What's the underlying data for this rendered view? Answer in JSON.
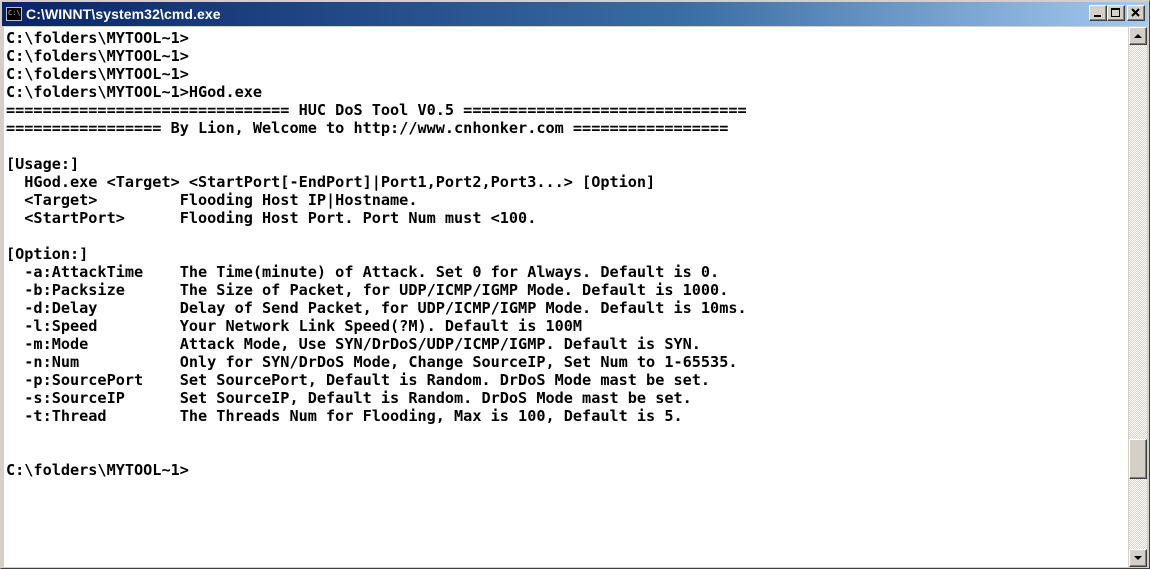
{
  "window": {
    "title": "C:\\WINNT\\system32\\cmd.exe",
    "icon_label": "C:\\"
  },
  "title_buttons": {
    "minimize_icon": "minimize-icon",
    "maximize_icon": "maximize-icon",
    "close_icon": "close-icon"
  },
  "console": {
    "lines": [
      "C:\\folders\\MYTOOL~1>",
      "C:\\folders\\MYTOOL~1>",
      "C:\\folders\\MYTOOL~1>",
      "C:\\folders\\MYTOOL~1>HGod.exe",
      "=============================== HUC DoS Tool V0.5 ===============================",
      "================= By Lion, Welcome to http://www.cnhonker.com =================",
      "",
      "[Usage:]",
      "  HGod.exe <Target> <StartPort[-EndPort]|Port1,Port2,Port3...> [Option]",
      "  <Target>         Flooding Host IP|Hostname.",
      "  <StartPort>      Flooding Host Port. Port Num must <100.",
      "",
      "[Option:]",
      "  -a:AttackTime    The Time(minute) of Attack. Set 0 for Always. Default is 0.",
      "  -b:Packsize      The Size of Packet, for UDP/ICMP/IGMP Mode. Default is 1000.",
      "  -d:Delay         Delay of Send Packet, for UDP/ICMP/IGMP Mode. Default is 10ms.",
      "  -l:Speed         Your Network Link Speed(?M). Default is 100M",
      "  -m:Mode          Attack Mode, Use SYN/DrDoS/UDP/ICMP/IGMP. Default is SYN.",
      "  -n:Num           Only for SYN/DrDoS Mode, Change SourceIP, Set Num to 1-65535.",
      "  -p:SourcePort    Set SourcePort, Default is Random. DrDoS Mode mast be set.",
      "  -s:SourceIP      Set SourceIP, Default is Random. DrDoS Mode mast be set.",
      "  -t:Thread        The Threads Num for Flooding, Max is 100, Default is 5.",
      "",
      "",
      "C:\\folders\\MYTOOL~1>"
    ]
  },
  "scrollbar": {
    "up_icon": "scroll-up-arrow-icon",
    "down_icon": "scroll-down-arrow-icon",
    "position_fraction": 0.85
  }
}
